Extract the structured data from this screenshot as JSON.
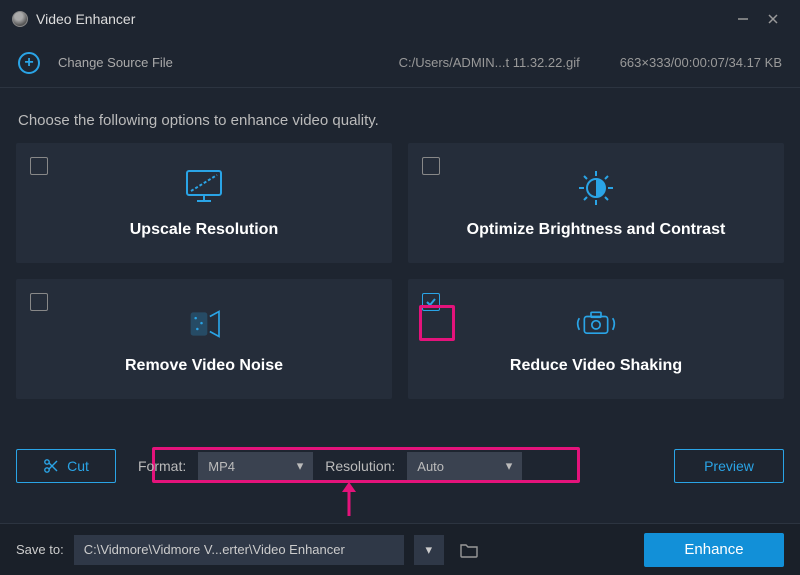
{
  "titlebar": {
    "title": "Video Enhancer"
  },
  "source": {
    "changeLabel": "Change Source File",
    "path": "C:/Users/ADMIN...t 11.32.22.gif",
    "meta": "663×333/00:00:07/34.17 KB"
  },
  "instruction": "Choose the following options to enhance video quality.",
  "cards": {
    "upscale": {
      "title": "Upscale Resolution",
      "checked": false
    },
    "brightness": {
      "title": "Optimize Brightness and Contrast",
      "checked": false
    },
    "noise": {
      "title": "Remove Video Noise",
      "checked": false
    },
    "shaking": {
      "title": "Reduce Video Shaking",
      "checked": true
    }
  },
  "controls": {
    "cutLabel": "Cut",
    "formatLabel": "Format:",
    "formatValue": "MP4",
    "resolutionLabel": "Resolution:",
    "resolutionValue": "Auto",
    "previewLabel": "Preview"
  },
  "footer": {
    "saveToLabel": "Save to:",
    "savePath": "C:\\Vidmore\\Vidmore V...erter\\Video Enhancer",
    "enhanceLabel": "Enhance"
  }
}
